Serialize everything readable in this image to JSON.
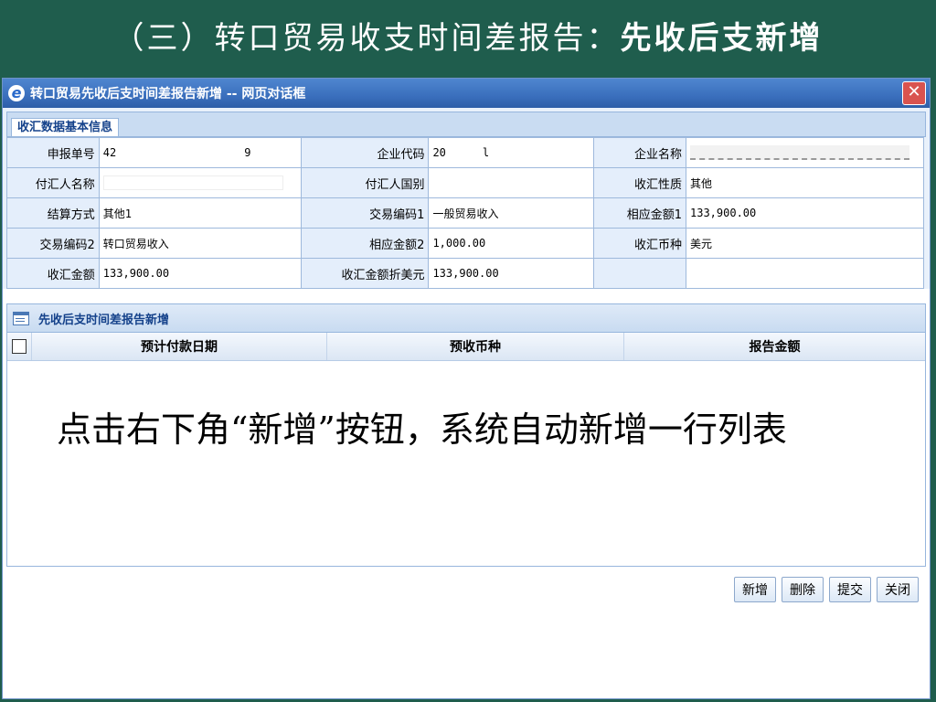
{
  "slide": {
    "title_prefix": "（三）转口贸易收支时间差报告：",
    "title_bold": "先收后支新增"
  },
  "dialog": {
    "title": "转口贸易先收后支时间差报告新增 -- 网页对话框",
    "close_label": "✕",
    "tab_label": "收汇数据基本信息",
    "info_rows": [
      [
        {
          "label": "申报单号",
          "value": "42",
          "value_tail": "9"
        },
        {
          "label": "企业代码",
          "value": "20",
          "value_tail": "l"
        },
        {
          "label": "企业名称",
          "value": ""
        }
      ],
      [
        {
          "label": "付汇人名称",
          "value": ""
        },
        {
          "label": "付汇人国别",
          "value": ""
        },
        {
          "label": "收汇性质",
          "value": "其他"
        }
      ],
      [
        {
          "label": "结算方式",
          "value": "其他1"
        },
        {
          "label": "交易编码1",
          "value": "一般贸易收入"
        },
        {
          "label": "相应金额1",
          "value": "133,900.00"
        }
      ],
      [
        {
          "label": "交易编码2",
          "value": "转口贸易收入"
        },
        {
          "label": "相应金额2",
          "value": "1,000.00"
        },
        {
          "label": "收汇币种",
          "value": "美元"
        }
      ],
      [
        {
          "label": "收汇金额",
          "value": "133,900.00"
        },
        {
          "label": "收汇金额折美元",
          "value": "133,900.00"
        },
        {
          "label": "",
          "value": ""
        }
      ]
    ],
    "grid": {
      "title": "先收后支时间差报告新增",
      "columns": [
        "预计付款日期",
        "预收币种",
        "报告金额"
      ]
    },
    "note": "点击右下角“新增”按钮，系统自动新增一行列表",
    "buttons": {
      "add": "新增",
      "delete": "删除",
      "submit": "提交",
      "close": "关闭"
    }
  }
}
